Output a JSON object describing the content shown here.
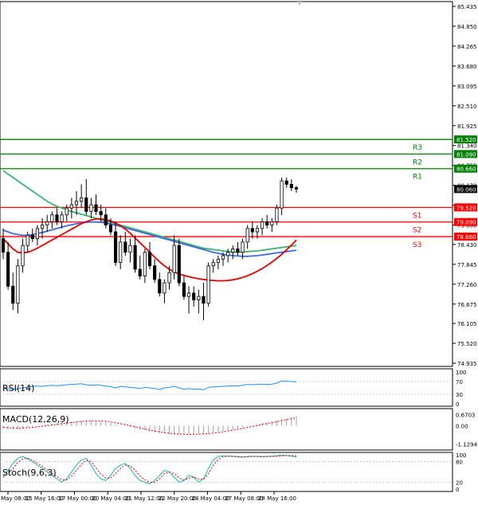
{
  "chart_data": {
    "type": "candlestick",
    "main": {
      "y_ticks": [
        "85.435",
        "84.850",
        "84.265",
        "83.680",
        "83.095",
        "82.510",
        "81.925",
        "81.340",
        "80.755",
        "80.170",
        "79.585",
        "79.000",
        "78.430",
        "77.845",
        "77.260",
        "76.675",
        "76.105",
        "75.520",
        "74.935"
      ],
      "ylim": [
        74.935,
        85.435
      ],
      "last_price": "80.060",
      "levels": [
        {
          "name": "R3",
          "value": 81.52,
          "tag": "81.520",
          "color": "#008000"
        },
        {
          "name": "R2",
          "value": 81.09,
          "tag": "81.090",
          "color": "#008000"
        },
        {
          "name": "R1",
          "value": 80.66,
          "tag": "80.660",
          "color": "#008000"
        },
        {
          "name": "S1",
          "value": 79.52,
          "tag": "79.520",
          "color": "#ff0000"
        },
        {
          "name": "S2",
          "value": 79.09,
          "tag": "79.090",
          "color": "#ff0000"
        },
        {
          "name": "S3",
          "value": 78.66,
          "tag": "78.660",
          "color": "#ff0000"
        }
      ],
      "candles": [
        [
          78.6,
          78.9,
          78.0,
          78.2
        ],
        [
          78.2,
          78.5,
          77.1,
          77.2
        ],
        [
          77.2,
          77.6,
          76.5,
          76.7
        ],
        [
          76.7,
          78.0,
          76.4,
          77.8
        ],
        [
          77.8,
          78.6,
          77.6,
          78.4
        ],
        [
          78.4,
          78.8,
          78.2,
          78.7
        ],
        [
          78.7,
          78.9,
          78.5,
          78.6
        ],
        [
          78.6,
          79.0,
          78.4,
          78.9
        ],
        [
          78.9,
          79.2,
          78.6,
          79.0
        ],
        [
          79.0,
          79.3,
          78.8,
          79.1
        ],
        [
          79.1,
          79.4,
          78.9,
          79.3
        ],
        [
          79.3,
          79.5,
          79.0,
          79.1
        ],
        [
          79.1,
          79.4,
          78.9,
          79.3
        ],
        [
          79.3,
          79.6,
          79.1,
          79.5
        ],
        [
          79.5,
          79.8,
          79.2,
          79.6
        ],
        [
          79.6,
          80.0,
          79.3,
          79.7
        ],
        [
          79.7,
          80.2,
          79.5,
          79.8
        ],
        [
          79.8,
          80.35,
          79.3,
          79.4
        ],
        [
          79.4,
          79.8,
          79.2,
          79.6
        ],
        [
          79.6,
          79.9,
          79.3,
          79.4
        ],
        [
          79.4,
          79.6,
          79.1,
          79.3
        ],
        [
          79.3,
          79.5,
          78.9,
          79.0
        ],
        [
          79.0,
          79.2,
          78.7,
          78.8
        ],
        [
          78.8,
          79.1,
          77.8,
          77.9
        ],
        [
          77.9,
          78.7,
          77.7,
          78.5
        ],
        [
          78.5,
          78.8,
          78.1,
          78.2
        ],
        [
          78.2,
          78.6,
          77.9,
          78.4
        ],
        [
          78.4,
          78.7,
          77.6,
          77.7
        ],
        [
          77.7,
          78.1,
          77.4,
          77.5
        ],
        [
          77.5,
          78.3,
          77.3,
          78.2
        ],
        [
          78.2,
          78.5,
          77.7,
          77.8
        ],
        [
          77.8,
          78.0,
          77.3,
          77.4
        ],
        [
          77.4,
          77.6,
          76.9,
          77.0
        ],
        [
          77.0,
          77.4,
          76.7,
          77.3
        ],
        [
          77.3,
          77.8,
          77.1,
          77.6
        ],
        [
          77.6,
          78.7,
          77.4,
          78.4
        ],
        [
          78.4,
          78.6,
          77.2,
          77.3
        ],
        [
          77.3,
          77.5,
          76.8,
          76.9
        ],
        [
          76.9,
          77.2,
          76.4,
          77.0
        ],
        [
          77.0,
          77.2,
          76.6,
          76.8
        ],
        [
          76.8,
          77.1,
          76.4,
          76.9
        ],
        [
          76.9,
          77.3,
          76.2,
          76.7
        ],
        [
          76.7,
          77.9,
          76.6,
          77.8
        ],
        [
          77.8,
          78.0,
          77.6,
          77.9
        ],
        [
          77.9,
          78.1,
          77.7,
          78.0
        ],
        [
          78.0,
          78.2,
          77.8,
          78.1
        ],
        [
          78.1,
          78.3,
          77.9,
          78.2
        ],
        [
          78.2,
          78.4,
          78.0,
          78.3
        ],
        [
          78.3,
          78.5,
          78.1,
          78.2
        ],
        [
          78.2,
          78.6,
          78.0,
          78.5
        ],
        [
          78.5,
          79.0,
          78.3,
          78.9
        ],
        [
          78.9,
          79.1,
          78.6,
          78.8
        ],
        [
          78.8,
          79.0,
          78.6,
          78.9
        ],
        [
          78.9,
          79.2,
          78.7,
          79.1
        ],
        [
          79.1,
          79.3,
          78.9,
          79.0
        ],
        [
          79.0,
          79.2,
          78.8,
          79.1
        ],
        [
          79.1,
          79.6,
          79.0,
          79.5
        ],
        [
          79.5,
          80.4,
          79.3,
          80.3
        ],
        [
          80.3,
          80.4,
          80.1,
          80.2
        ],
        [
          80.2,
          80.35,
          80.0,
          80.1
        ],
        [
          80.1,
          80.15,
          79.95,
          80.06
        ]
      ],
      "ma_green": [
        80.6,
        80.5,
        80.4,
        80.3,
        80.2,
        80.1,
        80.0,
        79.9,
        79.8,
        79.7,
        79.62,
        79.55,
        79.5,
        79.45,
        79.4,
        79.36,
        79.32,
        79.28,
        79.24,
        79.2,
        79.16,
        79.12,
        79.08,
        79.04,
        79.0,
        78.96,
        78.92,
        78.88,
        78.84,
        78.8,
        78.76,
        78.72,
        78.68,
        78.64,
        78.6,
        78.56,
        78.52,
        78.48,
        78.44,
        78.4,
        78.36,
        78.32,
        78.3,
        78.28,
        78.26,
        78.24,
        78.22,
        78.2,
        78.2,
        78.21,
        78.22,
        78.23,
        78.24,
        78.26,
        78.28,
        78.3,
        78.32,
        78.34,
        78.36,
        78.38,
        78.4
      ],
      "ma_blue": [
        78.85,
        78.8,
        78.75,
        78.72,
        78.7,
        78.7,
        78.72,
        78.75,
        78.78,
        78.82,
        78.86,
        78.9,
        78.94,
        78.98,
        79.01,
        79.04,
        79.06,
        79.08,
        79.09,
        79.09,
        79.08,
        79.06,
        79.03,
        79.0,
        78.96,
        78.92,
        78.88,
        78.84,
        78.8,
        78.76,
        78.72,
        78.68,
        78.64,
        78.6,
        78.56,
        78.52,
        78.48,
        78.44,
        78.4,
        78.36,
        78.32,
        78.28,
        78.24,
        78.2,
        78.17,
        78.14,
        78.12,
        78.1,
        78.09,
        78.08,
        78.08,
        78.09,
        78.1,
        78.12,
        78.14,
        78.16,
        78.18,
        78.2,
        78.22,
        78.24,
        78.26
      ],
      "ma_red": [
        78.6,
        78.45,
        78.3,
        78.2,
        78.18,
        78.2,
        78.25,
        78.32,
        78.4,
        78.48,
        78.56,
        78.64,
        78.72,
        78.8,
        78.88,
        78.96,
        79.04,
        79.1,
        79.15,
        79.18,
        79.18,
        79.16,
        79.12,
        79.06,
        78.98,
        78.88,
        78.76,
        78.62,
        78.48,
        78.34,
        78.2,
        78.06,
        77.92,
        77.8,
        77.7,
        77.62,
        77.56,
        77.52,
        77.48,
        77.45,
        77.42,
        77.4,
        77.38,
        77.37,
        77.36,
        77.36,
        77.37,
        77.39,
        77.42,
        77.46,
        77.51,
        77.57,
        77.64,
        77.72,
        77.81,
        77.91,
        78.02,
        78.14,
        78.27,
        78.41,
        78.56
      ]
    },
    "x_ticks": [
      "15 May 08:00",
      "15 May 16:00",
      "17 May 00:00",
      "20 May 04:00",
      "21 May 12:00",
      "22 May 20:00",
      "24 May 04:00",
      "27 May 08:00",
      "28 May 16:00"
    ],
    "rsi": {
      "title": "RSI(14)",
      "y_ticks": [
        "100",
        "70",
        "30",
        "0"
      ],
      "ylim": [
        0,
        100
      ],
      "values": [
        52,
        48,
        45,
        47,
        50,
        52,
        55,
        56,
        55,
        57,
        58,
        57,
        58,
        60,
        61,
        62,
        63,
        60,
        58,
        60,
        58,
        56,
        54,
        50,
        55,
        53,
        52,
        50,
        48,
        52,
        50,
        48,
        45,
        50,
        52,
        55,
        50,
        46,
        48,
        46,
        47,
        44,
        52,
        53,
        54,
        55,
        56,
        57,
        56,
        58,
        61,
        60,
        61,
        62,
        61,
        62,
        65,
        72,
        71,
        70,
        69
      ]
    },
    "macd": {
      "title": "MACD(12,26,9)",
      "y_ticks": [
        "0.6703",
        "0.00",
        "-1.1294"
      ],
      "ylim": [
        -1.35,
        0.8
      ],
      "hist": [
        -0.15,
        -0.2,
        -0.22,
        -0.2,
        -0.16,
        -0.12,
        -0.08,
        -0.04,
        0.0,
        0.05,
        0.09,
        0.13,
        0.17,
        0.21,
        0.25,
        0.28,
        0.31,
        0.33,
        0.33,
        0.31,
        0.27,
        0.22,
        0.16,
        0.08,
        0.02,
        -0.04,
        -0.1,
        -0.17,
        -0.24,
        -0.3,
        -0.36,
        -0.41,
        -0.46,
        -0.49,
        -0.52,
        -0.53,
        -0.54,
        -0.55,
        -0.55,
        -0.54,
        -0.52,
        -0.5,
        -0.46,
        -0.42,
        -0.38,
        -0.33,
        -0.28,
        -0.23,
        -0.17,
        -0.11,
        -0.05,
        0.01,
        0.07,
        0.13,
        0.19,
        0.25,
        0.31,
        0.38,
        0.45,
        0.52,
        0.58
      ],
      "signal": [
        -0.1,
        -0.13,
        -0.15,
        -0.16,
        -0.15,
        -0.13,
        -0.11,
        -0.08,
        -0.04,
        0.0,
        0.04,
        0.08,
        0.12,
        0.16,
        0.2,
        0.23,
        0.26,
        0.28,
        0.3,
        0.3,
        0.29,
        0.27,
        0.23,
        0.18,
        0.12,
        0.06,
        0.0,
        -0.07,
        -0.14,
        -0.21,
        -0.27,
        -0.33,
        -0.38,
        -0.43,
        -0.47,
        -0.5,
        -0.52,
        -0.53,
        -0.54,
        -0.54,
        -0.53,
        -0.51,
        -0.49,
        -0.46,
        -0.42,
        -0.38,
        -0.33,
        -0.28,
        -0.23,
        -0.17,
        -0.11,
        -0.05,
        0.01,
        0.07,
        0.13,
        0.19,
        0.25,
        0.31,
        0.37,
        0.43,
        0.48
      ]
    },
    "stoch": {
      "title": "Stoch(9,6,3)",
      "y_ticks": [
        "100",
        "80",
        "20",
        "0"
      ],
      "ylim": [
        0,
        100
      ],
      "main": [
        40,
        55,
        75,
        90,
        95,
        88,
        80,
        70,
        60,
        50,
        40,
        30,
        20,
        30,
        50,
        70,
        85,
        90,
        70,
        45,
        30,
        25,
        40,
        60,
        70,
        75,
        60,
        40,
        25,
        20,
        15,
        25,
        40,
        55,
        50,
        35,
        20,
        25,
        40,
        35,
        20,
        30,
        60,
        85,
        95,
        97,
        96,
        95,
        94,
        93,
        95,
        96,
        95,
        94,
        95,
        96,
        97,
        99,
        98,
        96,
        94
      ],
      "signal": [
        35,
        45,
        60,
        78,
        88,
        90,
        85,
        76,
        66,
        56,
        46,
        36,
        28,
        27,
        38,
        55,
        72,
        84,
        80,
        62,
        44,
        32,
        32,
        45,
        60,
        70,
        68,
        55,
        38,
        27,
        20,
        20,
        30,
        45,
        50,
        45,
        32,
        26,
        32,
        35,
        30,
        28,
        45,
        70,
        87,
        94,
        96,
        96,
        95,
        94,
        94,
        95,
        95,
        95,
        95,
        95,
        96,
        97,
        98,
        98,
        97
      ]
    }
  }
}
